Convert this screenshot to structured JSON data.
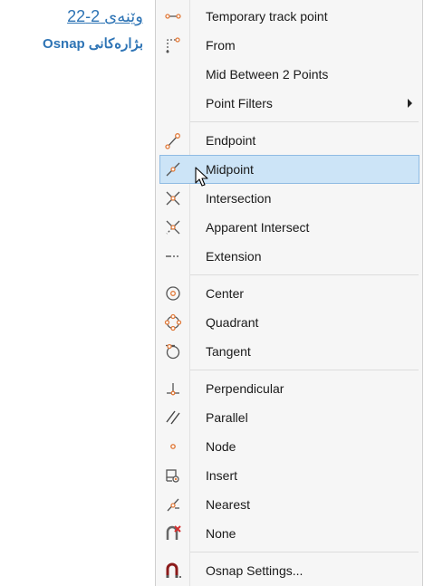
{
  "caption": {
    "figure_label": "وێنەی 2-22",
    "figure_title": "بژارەكانی Osnap"
  },
  "menu": {
    "items": [
      {
        "label": "Temporary track point",
        "icon": "temporary-track-point-icon"
      },
      {
        "label": "From",
        "icon": "from-icon"
      },
      {
        "label": "Mid Between 2 Points",
        "icon": ""
      },
      {
        "label": "Point Filters",
        "icon": "",
        "submenu": true
      },
      {
        "label": "Endpoint",
        "icon": "endpoint-icon"
      },
      {
        "label": "Midpoint",
        "icon": "midpoint-icon",
        "highlighted": true
      },
      {
        "label": "Intersection",
        "icon": "intersection-icon"
      },
      {
        "label": "Apparent Intersect",
        "icon": "apparent-intersect-icon"
      },
      {
        "label": "Extension",
        "icon": "extension-icon"
      },
      {
        "label": "Center",
        "icon": "center-icon"
      },
      {
        "label": "Quadrant",
        "icon": "quadrant-icon"
      },
      {
        "label": "Tangent",
        "icon": "tangent-icon"
      },
      {
        "label": "Perpendicular",
        "icon": "perpendicular-icon"
      },
      {
        "label": "Parallel",
        "icon": "parallel-icon"
      },
      {
        "label": "Node",
        "icon": "node-icon"
      },
      {
        "label": "Insert",
        "icon": "insert-icon"
      },
      {
        "label": "Nearest",
        "icon": "nearest-icon"
      },
      {
        "label": "None",
        "icon": "none-icon"
      },
      {
        "label": "Osnap Settings...",
        "icon": "osnap-settings-icon"
      }
    ]
  },
  "colors": {
    "accent": "#e07a3a",
    "highlight_bg": "#cce4f7",
    "highlight_border": "#8fbbe3",
    "caption": "#2e74b5"
  }
}
